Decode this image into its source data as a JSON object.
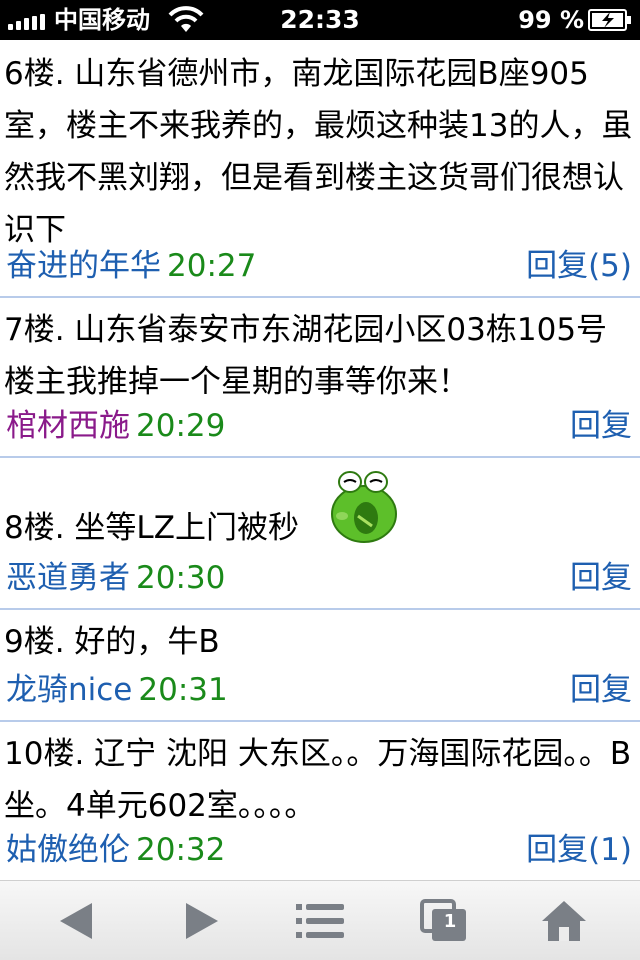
{
  "status_bar": {
    "carrier": "中国移动",
    "time": "22:33",
    "battery_percent": "99 %"
  },
  "posts": [
    {
      "text": "6楼. 山东省德州市，南龙国际花园B座905室，楼主不来我养的，最烦这种装13的人，虽然我不黑刘翔，但是看到楼主这货哥们很想认识下",
      "author": "奋进的年华",
      "time": "20:27",
      "reply": "回复(5)"
    },
    {
      "text": "7楼. 山东省泰安市东湖花园小区03栋105号 楼主我推掉一个星期的事等你来！",
      "author": "棺材西施",
      "time": "20:29",
      "reply": "回复"
    },
    {
      "text": "8楼. 坐等LZ上门被秒",
      "author": "恶道勇者",
      "time": "20:30",
      "reply": "回复"
    },
    {
      "text": "9楼. 好的，牛B",
      "author": "龙骑nice",
      "time": "20:31",
      "reply": "回复"
    },
    {
      "text": "10楼. 辽宁 沈阳 大东区。。万海国际花园。。B坐。4单元602室。。。。",
      "author": "姑傲绝伦",
      "time": "20:32",
      "reply": "回复(1)"
    }
  ],
  "toolbar": {
    "tabs_count": "1",
    "icons": [
      "back-icon",
      "forward-icon",
      "menu-list-icon",
      "tabs-icon",
      "home-icon"
    ]
  },
  "colors": {
    "link_blue": "#1e5fb0",
    "time_green": "#1a8a1a",
    "author_purple": "#8a1a8a",
    "divider": "#b8cbea"
  }
}
